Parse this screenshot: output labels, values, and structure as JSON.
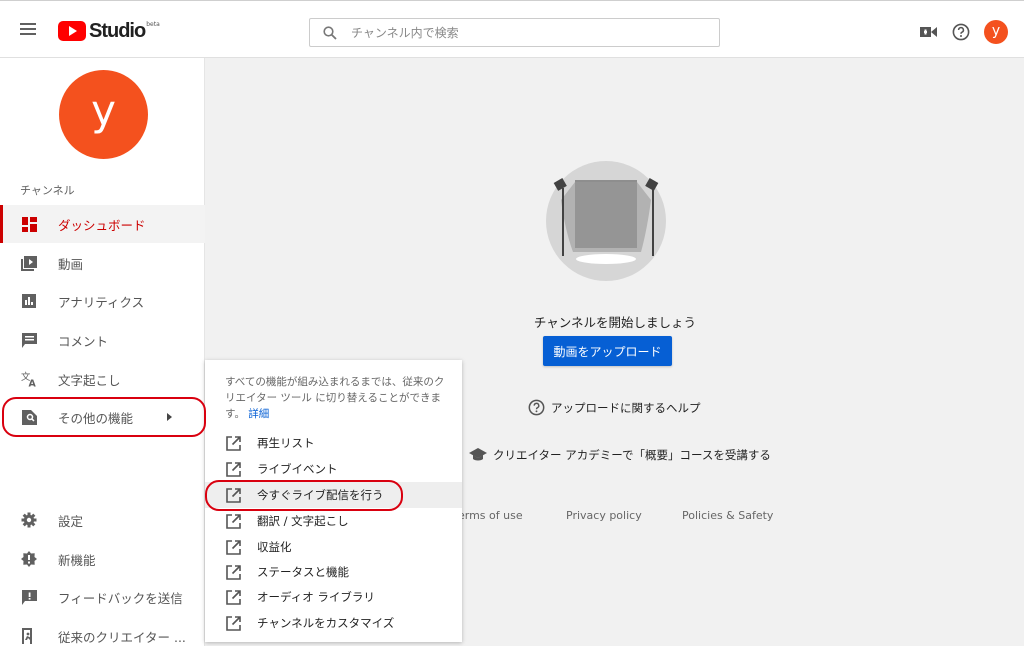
{
  "header": {
    "logo_text": "Studio",
    "logo_badge": "beta",
    "search_placeholder": "チャンネル内で検索",
    "avatar_letter": "y"
  },
  "sidebar": {
    "avatar_letter": "y",
    "channel_label": "チャンネル",
    "items": [
      {
        "label": "ダッシュボード",
        "icon": "dashboard-icon",
        "active": true
      },
      {
        "label": "動画",
        "icon": "video-icon"
      },
      {
        "label": "アナリティクス",
        "icon": "analytics-icon"
      },
      {
        "label": "コメント",
        "icon": "comment-icon"
      },
      {
        "label": "文字起こし",
        "icon": "translate-icon"
      },
      {
        "label": "その他の機能",
        "icon": "other-features-icon"
      }
    ],
    "bottom_items": [
      {
        "label": "設定",
        "icon": "gear-icon"
      },
      {
        "label": "新機能",
        "icon": "new-feature-icon"
      },
      {
        "label": "フィードバックを送信",
        "icon": "feedback-icon"
      },
      {
        "label": "従来のクリエイター ...",
        "icon": "classic-studio-icon"
      }
    ]
  },
  "popup": {
    "description": "すべての機能が組み込まれるまでは、従来のクリエイター ツール に切り替えることができます。",
    "link": "詳細",
    "items": [
      "再生リスト",
      "ライブイベント",
      "今すぐライブ配信を行う",
      "翻訳 / 文字起こし",
      "収益化",
      "ステータスと機能",
      "オーディオ ライブラリ",
      "チャンネルをカスタマイズ"
    ]
  },
  "main": {
    "start_text": "チャンネルを開始しましょう",
    "upload_button": "動画をアップロード",
    "help_link": "アップロードに関するヘルプ",
    "academy_link": "クリエイター アカデミーで「概要」コースを受講する",
    "footer": [
      "erms of use",
      "Privacy policy",
      "Policies & Safety"
    ]
  },
  "colors": {
    "accent": "#065fd4",
    "brand_red": "#ff0000",
    "avatar": "#f4511e",
    "active": "#cc0000",
    "annotation_red": "#d9000f"
  }
}
